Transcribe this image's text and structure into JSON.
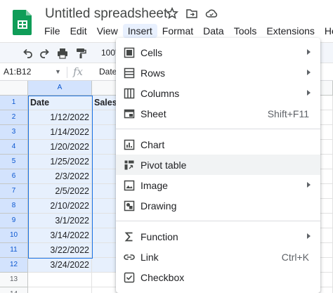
{
  "app": {
    "title": "Untitled spreadsheet",
    "icons": [
      "star-icon",
      "move-to-folder-icon",
      "cloud-status-icon"
    ]
  },
  "menubar": [
    "File",
    "Edit",
    "View",
    "Insert",
    "Format",
    "Data",
    "Tools",
    "Extensions",
    "Help"
  ],
  "toolbar": {
    "zoom": "100'",
    "icons": [
      "undo-icon",
      "redo-icon",
      "print-icon",
      "paint-format-icon"
    ]
  },
  "formula_bar": {
    "name_box": "A1:B12",
    "fx": "fx",
    "value": "Date"
  },
  "grid": {
    "column_headers": [
      "A",
      ""
    ],
    "rows": [
      {
        "n": "1",
        "a": "Date",
        "b": "Sales"
      },
      {
        "n": "2",
        "a": "1/12/2022",
        "b": ""
      },
      {
        "n": "3",
        "a": "1/14/2022",
        "b": ""
      },
      {
        "n": "4",
        "a": "1/20/2022",
        "b": ""
      },
      {
        "n": "5",
        "a": "1/25/2022",
        "b": ""
      },
      {
        "n": "6",
        "a": "2/3/2022",
        "b": ""
      },
      {
        "n": "7",
        "a": "2/5/2022",
        "b": ""
      },
      {
        "n": "8",
        "a": "2/10/2022",
        "b": ""
      },
      {
        "n": "9",
        "a": "3/1/2022",
        "b": ""
      },
      {
        "n": "10",
        "a": "3/14/2022",
        "b": ""
      },
      {
        "n": "11",
        "a": "3/22/2022",
        "b": ""
      },
      {
        "n": "12",
        "a": "3/24/2022",
        "b": ""
      },
      {
        "n": "13",
        "a": "",
        "b": ""
      },
      {
        "n": "14",
        "a": "",
        "b": ""
      }
    ]
  },
  "insert_menu": {
    "groups": [
      [
        {
          "label": "Cells",
          "icon": "cells-icon",
          "submenu": true
        },
        {
          "label": "Rows",
          "icon": "rows-icon",
          "submenu": true
        },
        {
          "label": "Columns",
          "icon": "columns-icon",
          "submenu": true
        },
        {
          "label": "Sheet",
          "icon": "sheet-icon",
          "shortcut": "Shift+F11"
        }
      ],
      [
        {
          "label": "Chart",
          "icon": "chart-icon"
        },
        {
          "label": "Pivot table",
          "icon": "pivot-table-icon",
          "hover": true
        },
        {
          "label": "Image",
          "icon": "image-icon",
          "submenu": true
        },
        {
          "label": "Drawing",
          "icon": "drawing-icon"
        }
      ],
      [
        {
          "label": "Function",
          "icon": "function-icon",
          "submenu": true
        },
        {
          "label": "Link",
          "icon": "link-icon",
          "shortcut": "Ctrl+K"
        },
        {
          "label": "Checkbox",
          "icon": "checkbox-icon"
        }
      ]
    ]
  },
  "colors": {
    "accent": "#1a73e8",
    "selection_fill": "#e7f0fd",
    "active_menu": "#e8f0fe",
    "sheets_green": "#0f9d58"
  }
}
